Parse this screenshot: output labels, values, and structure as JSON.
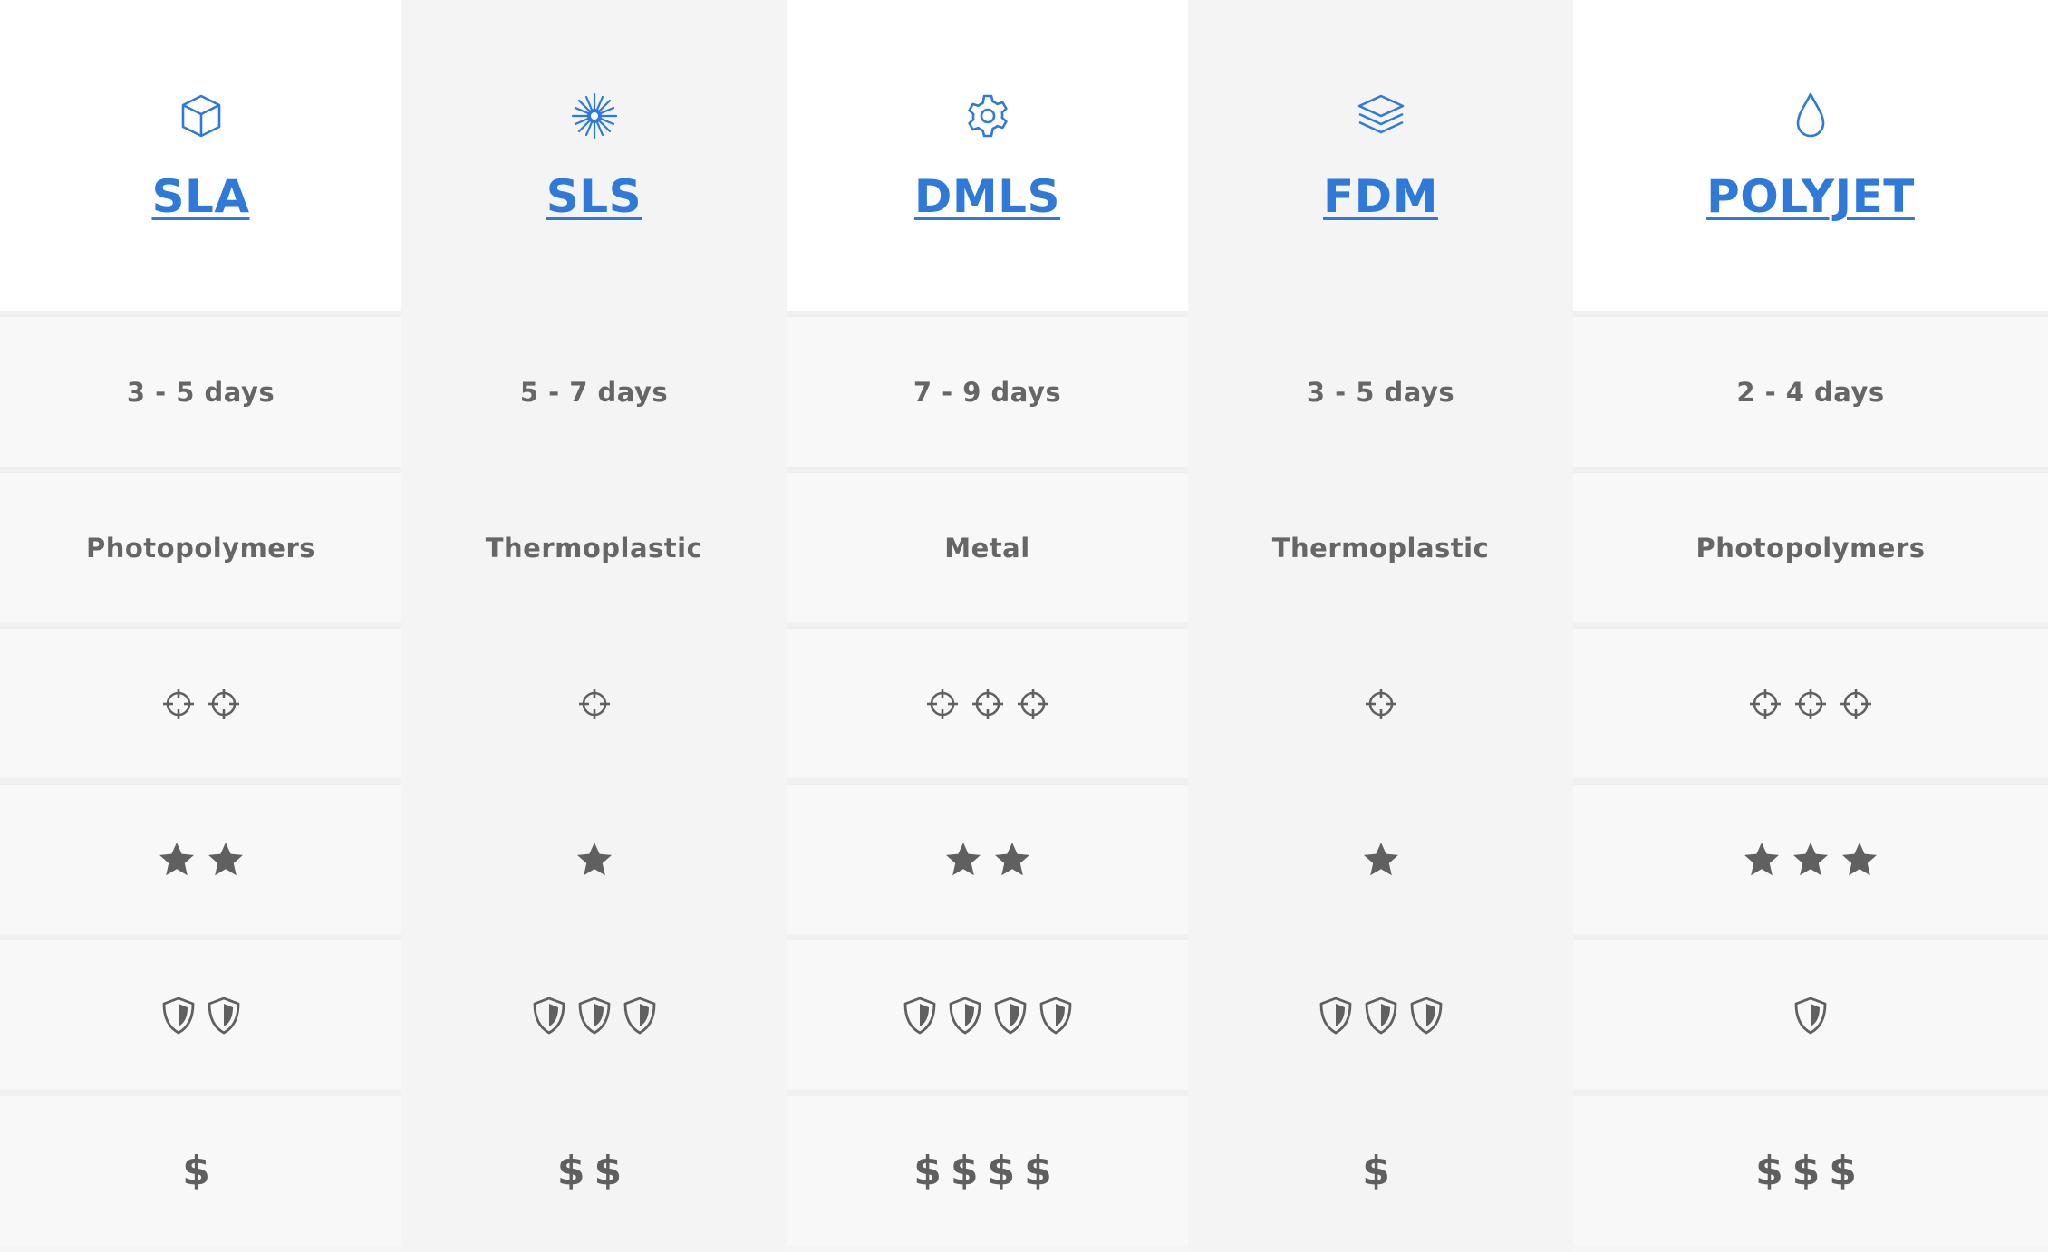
{
  "columns": [
    {
      "title": "SLA",
      "icon": "cube-icon",
      "lead_time": "3 - 5 days",
      "material": "Photopolymers",
      "accuracy": 2,
      "finish": 2,
      "strength": 2,
      "cost": "$"
    },
    {
      "title": "SLS",
      "icon": "laser-burst-icon",
      "lead_time": "5 - 7 days",
      "material": "Thermoplastic",
      "accuracy": 1,
      "finish": 1,
      "strength": 3,
      "cost": "$$"
    },
    {
      "title": "DMLS",
      "icon": "gear-icon",
      "lead_time": "7 - 9 days",
      "material": "Metal",
      "accuracy": 3,
      "finish": 2,
      "strength": 4,
      "cost": "$$$$"
    },
    {
      "title": "FDM",
      "icon": "layers-icon",
      "lead_time": "3 - 5 days",
      "material": "Thermoplastic",
      "accuracy": 1,
      "finish": 1,
      "strength": 3,
      "cost": "$"
    },
    {
      "title": "POLYJET",
      "icon": "droplet-icon",
      "lead_time": "2 - 4 days",
      "material": "Photopolymers",
      "accuracy": 3,
      "finish": 3,
      "strength": 1,
      "cost": "$$$"
    }
  ],
  "colors": {
    "accent": "#2f7ad8",
    "text": "#666666",
    "icon_gray": "#606060"
  }
}
